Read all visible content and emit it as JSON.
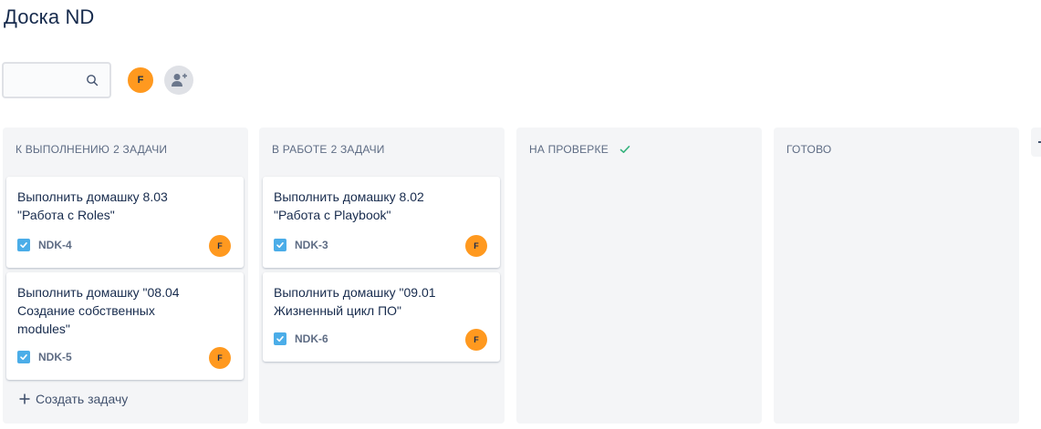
{
  "board": {
    "title": "Доска ND"
  },
  "search": {
    "placeholder": "",
    "value": ""
  },
  "users": [
    {
      "initial": "F"
    }
  ],
  "colors": {
    "accent_orange": "#ff991f",
    "task_blue": "#4bade8",
    "done_green": "#36b37e",
    "column_bg": "#f4f5f7",
    "text_primary": "#172b4d",
    "text_secondary": "#5e6c84"
  },
  "columns": [
    {
      "title": "К выполнению",
      "count": "2 задачи",
      "cards": [
        {
          "title": "Выполнить домашку 8.03\n\"Работа с Roles\"",
          "key": "NDK-4",
          "assignee": "F",
          "icon": "task-checkbox-icon"
        },
        {
          "title": "Выполнить домашку \"08.04\nСоздание собственных\nmodules\"",
          "key": "NDK-5",
          "assignee": "F",
          "icon": "task-checkbox-icon"
        }
      ],
      "create_label": "Создать задачу"
    },
    {
      "title": "В работе",
      "count": "2 задачи",
      "cards": [
        {
          "title": "Выполнить домашку 8.02\n\"Работа с Playbook\"",
          "key": "NDK-3",
          "assignee": "F",
          "icon": "task-checkbox-icon"
        },
        {
          "title": "Выполнить домашку \"09.01\nЖизненный цикл ПО\"",
          "key": "NDK-6",
          "assignee": "F",
          "icon": "task-checkbox-icon"
        }
      ]
    },
    {
      "title": "На проверке",
      "count": "",
      "cards": [],
      "icon": "check-icon"
    },
    {
      "title": "Готово",
      "count": "",
      "cards": []
    }
  ]
}
